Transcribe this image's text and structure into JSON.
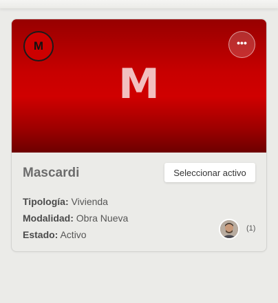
{
  "card": {
    "badge_letter": "M",
    "hero_letter": "M",
    "more_icon": "ellipsis-icon",
    "more_label": "•••",
    "title": "Mascardi",
    "select_button_label": "Seleccionar activo",
    "fields": [
      {
        "label": "Tipología:",
        "value": "Vivienda"
      },
      {
        "label": "Modalidad:",
        "value": "Obra Nueva"
      },
      {
        "label": "Estado:",
        "value": "Activo"
      }
    ],
    "users_count": "(1)"
  },
  "colors": {
    "brand_red": "#cc0000",
    "dark_red": "#6d0000"
  }
}
